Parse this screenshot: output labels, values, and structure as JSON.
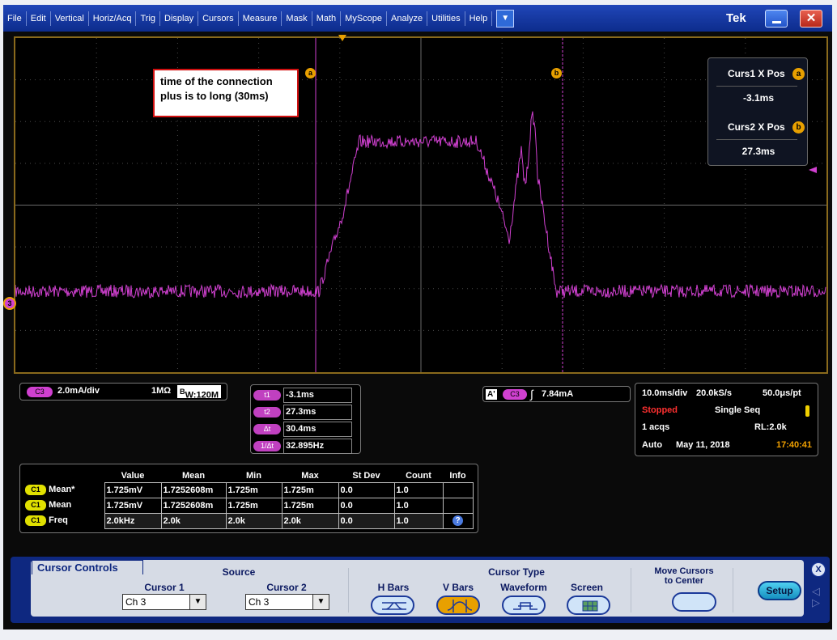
{
  "menu": {
    "items": [
      "File",
      "Edit",
      "Vertical",
      "Horiz/Acq",
      "Trig",
      "Display",
      "Cursors",
      "Measure",
      "Mask",
      "Math",
      "MyScope",
      "Analyze",
      "Utilities",
      "Help"
    ]
  },
  "window": {
    "brand": "Tek"
  },
  "colors": {
    "trace": "#d040d0",
    "cursor": "#d040d0",
    "graticule_border": "#8a6a1c",
    "accent": "#e8a000"
  },
  "annotation": {
    "line1": "time of the connection",
    "line2": "plus is to long (30ms)"
  },
  "cursor_markers": {
    "a": "a",
    "b": "b"
  },
  "readout": {
    "curs1_label": "Curs1 X Pos",
    "curs1_badge": "a",
    "curs1_value": "-3.1ms",
    "curs2_label": "Curs2 X Pos",
    "curs2_badge": "b",
    "curs2_value": "27.3ms"
  },
  "channel": {
    "marker": "3",
    "name": "C3",
    "scale": "2.0mA/div",
    "impedance": "1MΩ",
    "bw_prefix": "B",
    "bw_value": "W:120M"
  },
  "cursor_table": [
    {
      "label": "t1",
      "value": "-3.1ms"
    },
    {
      "label": "t2",
      "value": "27.3ms"
    },
    {
      "label": "Δt",
      "value": "30.4ms"
    },
    {
      "label": "1/Δt",
      "value": "32.895Hz"
    }
  ],
  "trigger": {
    "mode": "A'",
    "channel": "C3",
    "level": "7.84mA"
  },
  "horizontal": {
    "timebase": "10.0ms/div",
    "sample_rate": "20.0kS/s",
    "resolution": "50.0μs/pt",
    "state": "Stopped",
    "seq_mode": "Single Seq",
    "acqs": "1 acqs",
    "record_length": "RL:2.0k",
    "trig_mode": "Auto",
    "date": "May 11, 2018",
    "time": "17:40:41"
  },
  "measurements": {
    "headers": [
      "Value",
      "Mean",
      "Min",
      "Max",
      "St Dev",
      "Count",
      "Info"
    ],
    "rows": [
      {
        "ch": "C1",
        "name": "Mean*",
        "value": "1.725mV",
        "mean": "1.7252608m",
        "min": "1.725m",
        "max": "1.725m",
        "stdev": "0.0",
        "count": "1.0",
        "info": ""
      },
      {
        "ch": "C1",
        "name": "Mean",
        "value": "1.725mV",
        "mean": "1.7252608m",
        "min": "1.725m",
        "max": "1.725m",
        "stdev": "0.0",
        "count": "1.0",
        "info": ""
      },
      {
        "ch": "C1",
        "name": "Freq",
        "value": "2.0kHz",
        "mean": "2.0k",
        "min": "2.0k",
        "max": "2.0k",
        "stdev": "0.0",
        "count": "1.0",
        "info": "?"
      }
    ]
  },
  "cursor_controls": {
    "title": "Cursor Controls",
    "source_label": "Source",
    "cursor1_label": "Cursor 1",
    "cursor1_value": "Ch 3",
    "cursor2_label": "Cursor 2",
    "cursor2_value": "Ch 3",
    "type_label": "Cursor Type",
    "types": [
      "H Bars",
      "V Bars",
      "Waveform",
      "Screen"
    ],
    "selected_type": "V Bars",
    "move_label_1": "Move Cursors",
    "move_label_2": "to Center",
    "setup_label": "Setup",
    "close_glyph": "X"
  }
}
